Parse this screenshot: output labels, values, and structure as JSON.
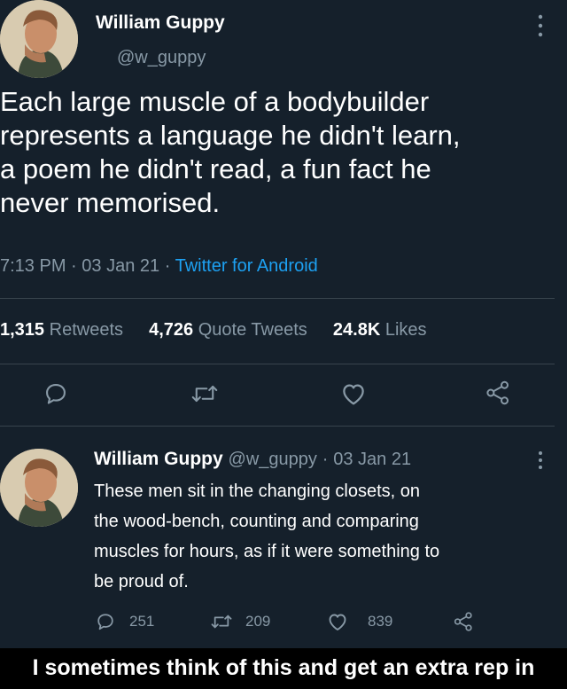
{
  "tweet": {
    "author_name": "William Guppy",
    "author_handle": "@w_guppy",
    "text_lines": [
      "Each large muscle of a bodybuilder",
      "represents a language he didn't learn,",
      "a poem he didn't read, a fun fact he",
      "never memorised."
    ],
    "time": "7:13 PM",
    "date": "03 Jan 21",
    "separator": "·",
    "source": "Twitter for Android"
  },
  "stats": {
    "retweets_count": "1,315",
    "retweets_label": "Retweets",
    "quotes_count": "4,726",
    "quotes_label": "Quote Tweets",
    "likes_count": "24.8K",
    "likes_label": "Likes"
  },
  "reply": {
    "author_name": "William Guppy",
    "author_handle": "@w_guppy",
    "date": "03 Jan 21",
    "separator": "·",
    "text_lines": [
      "These men sit in the changing closets, on",
      "the wood-bench, counting and comparing",
      "muscles for hours, as if it were something to",
      "be proud of."
    ],
    "reply_count": "251",
    "retweet_count": "209",
    "like_count": "839"
  },
  "caption": "I sometimes think of this and get an extra rep in",
  "colors": {
    "background": "#15202b",
    "secondary_text": "#8899a6",
    "link": "#1da1f2",
    "divider": "#38444d",
    "caption_bg": "#000000"
  },
  "icons": [
    "more-icon",
    "reply-icon",
    "retweet-icon",
    "like-icon",
    "share-icon"
  ]
}
